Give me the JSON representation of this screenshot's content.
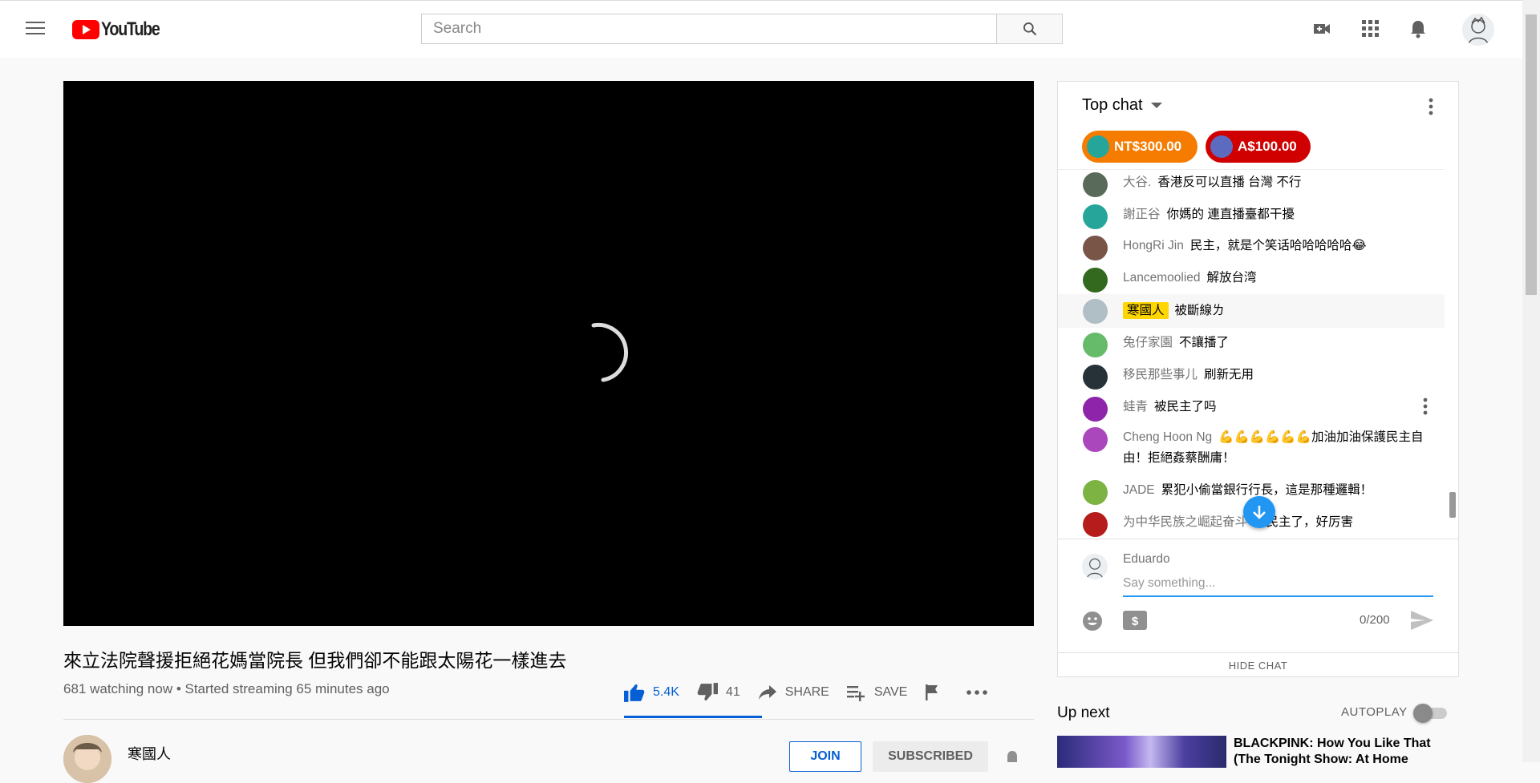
{
  "masthead": {
    "logo_text": "YouTube",
    "search_placeholder": "Search"
  },
  "video": {
    "title": "來立法院聲援拒絕花媽當院長 但我們卻不能跟太陽花一樣進去",
    "meta": "681 watching now • Started streaming 65 minutes ago",
    "likes": "5.4K",
    "dislikes": "41",
    "share_label": "SHARE",
    "save_label": "SAVE"
  },
  "channel": {
    "name": "寒國人",
    "join_label": "JOIN",
    "subscribed_label": "SUBSCRIBED"
  },
  "chat": {
    "header": "Top chat",
    "tickers": [
      {
        "amount": "NT$300.00",
        "color": "#f57c00"
      },
      {
        "amount": "A$100.00",
        "color": "#d00000"
      }
    ],
    "messages": [
      {
        "author": "大谷.",
        "text": "香港反可以直播 台灣 不行",
        "avatar_color": "#5a6a5a"
      },
      {
        "author": "謝正谷",
        "text": "你媽的 連直播臺都干擾",
        "avatar_color": "#26a69a"
      },
      {
        "author": "HongRi Jin",
        "text": "民主，就是个笑话哈哈哈哈哈😂",
        "avatar_color": "#795548"
      },
      {
        "author": "Lancemoolied",
        "text": "解放台湾",
        "avatar_color": "#33691e"
      },
      {
        "author": "寒國人",
        "text": "被斷線ㄌ",
        "avatar_color": "#b0bec5",
        "owner": true
      },
      {
        "author": "兔仔家園",
        "text": "不讓播了",
        "avatar_color": "#66bb6a"
      },
      {
        "author": "移民那些事儿",
        "text": "刷新无用",
        "avatar_color": "#263238"
      },
      {
        "author": "蛙青",
        "text": "被民主了吗",
        "avatar_color": "#8e24aa"
      },
      {
        "author": "Cheng Hoon Ng",
        "text": "💪💪💪💪💪💪加油加油保護民主自由！拒絕姦蔡酬庸！",
        "avatar_color": "#ab47bc"
      },
      {
        "author": "JADE",
        "text": "累犯小偷當銀行行長，這是那種邏輯！",
        "avatar_color": "#7cb342"
      },
      {
        "author": "为中华民族之崛起奋斗",
        "text": "被民主了，好厉害",
        "avatar_color": "#b71c1c"
      }
    ],
    "input": {
      "user_name": "Eduardo",
      "placeholder": "Say something...",
      "char_count": "0/200"
    },
    "hide_label": "HIDE CHAT"
  },
  "up_next": {
    "label": "Up next",
    "autoplay_label": "AUTOPLAY",
    "autoplay_on": false,
    "video_title": "BLACKPINK: How You Like That (The Tonight Show: At Home"
  }
}
